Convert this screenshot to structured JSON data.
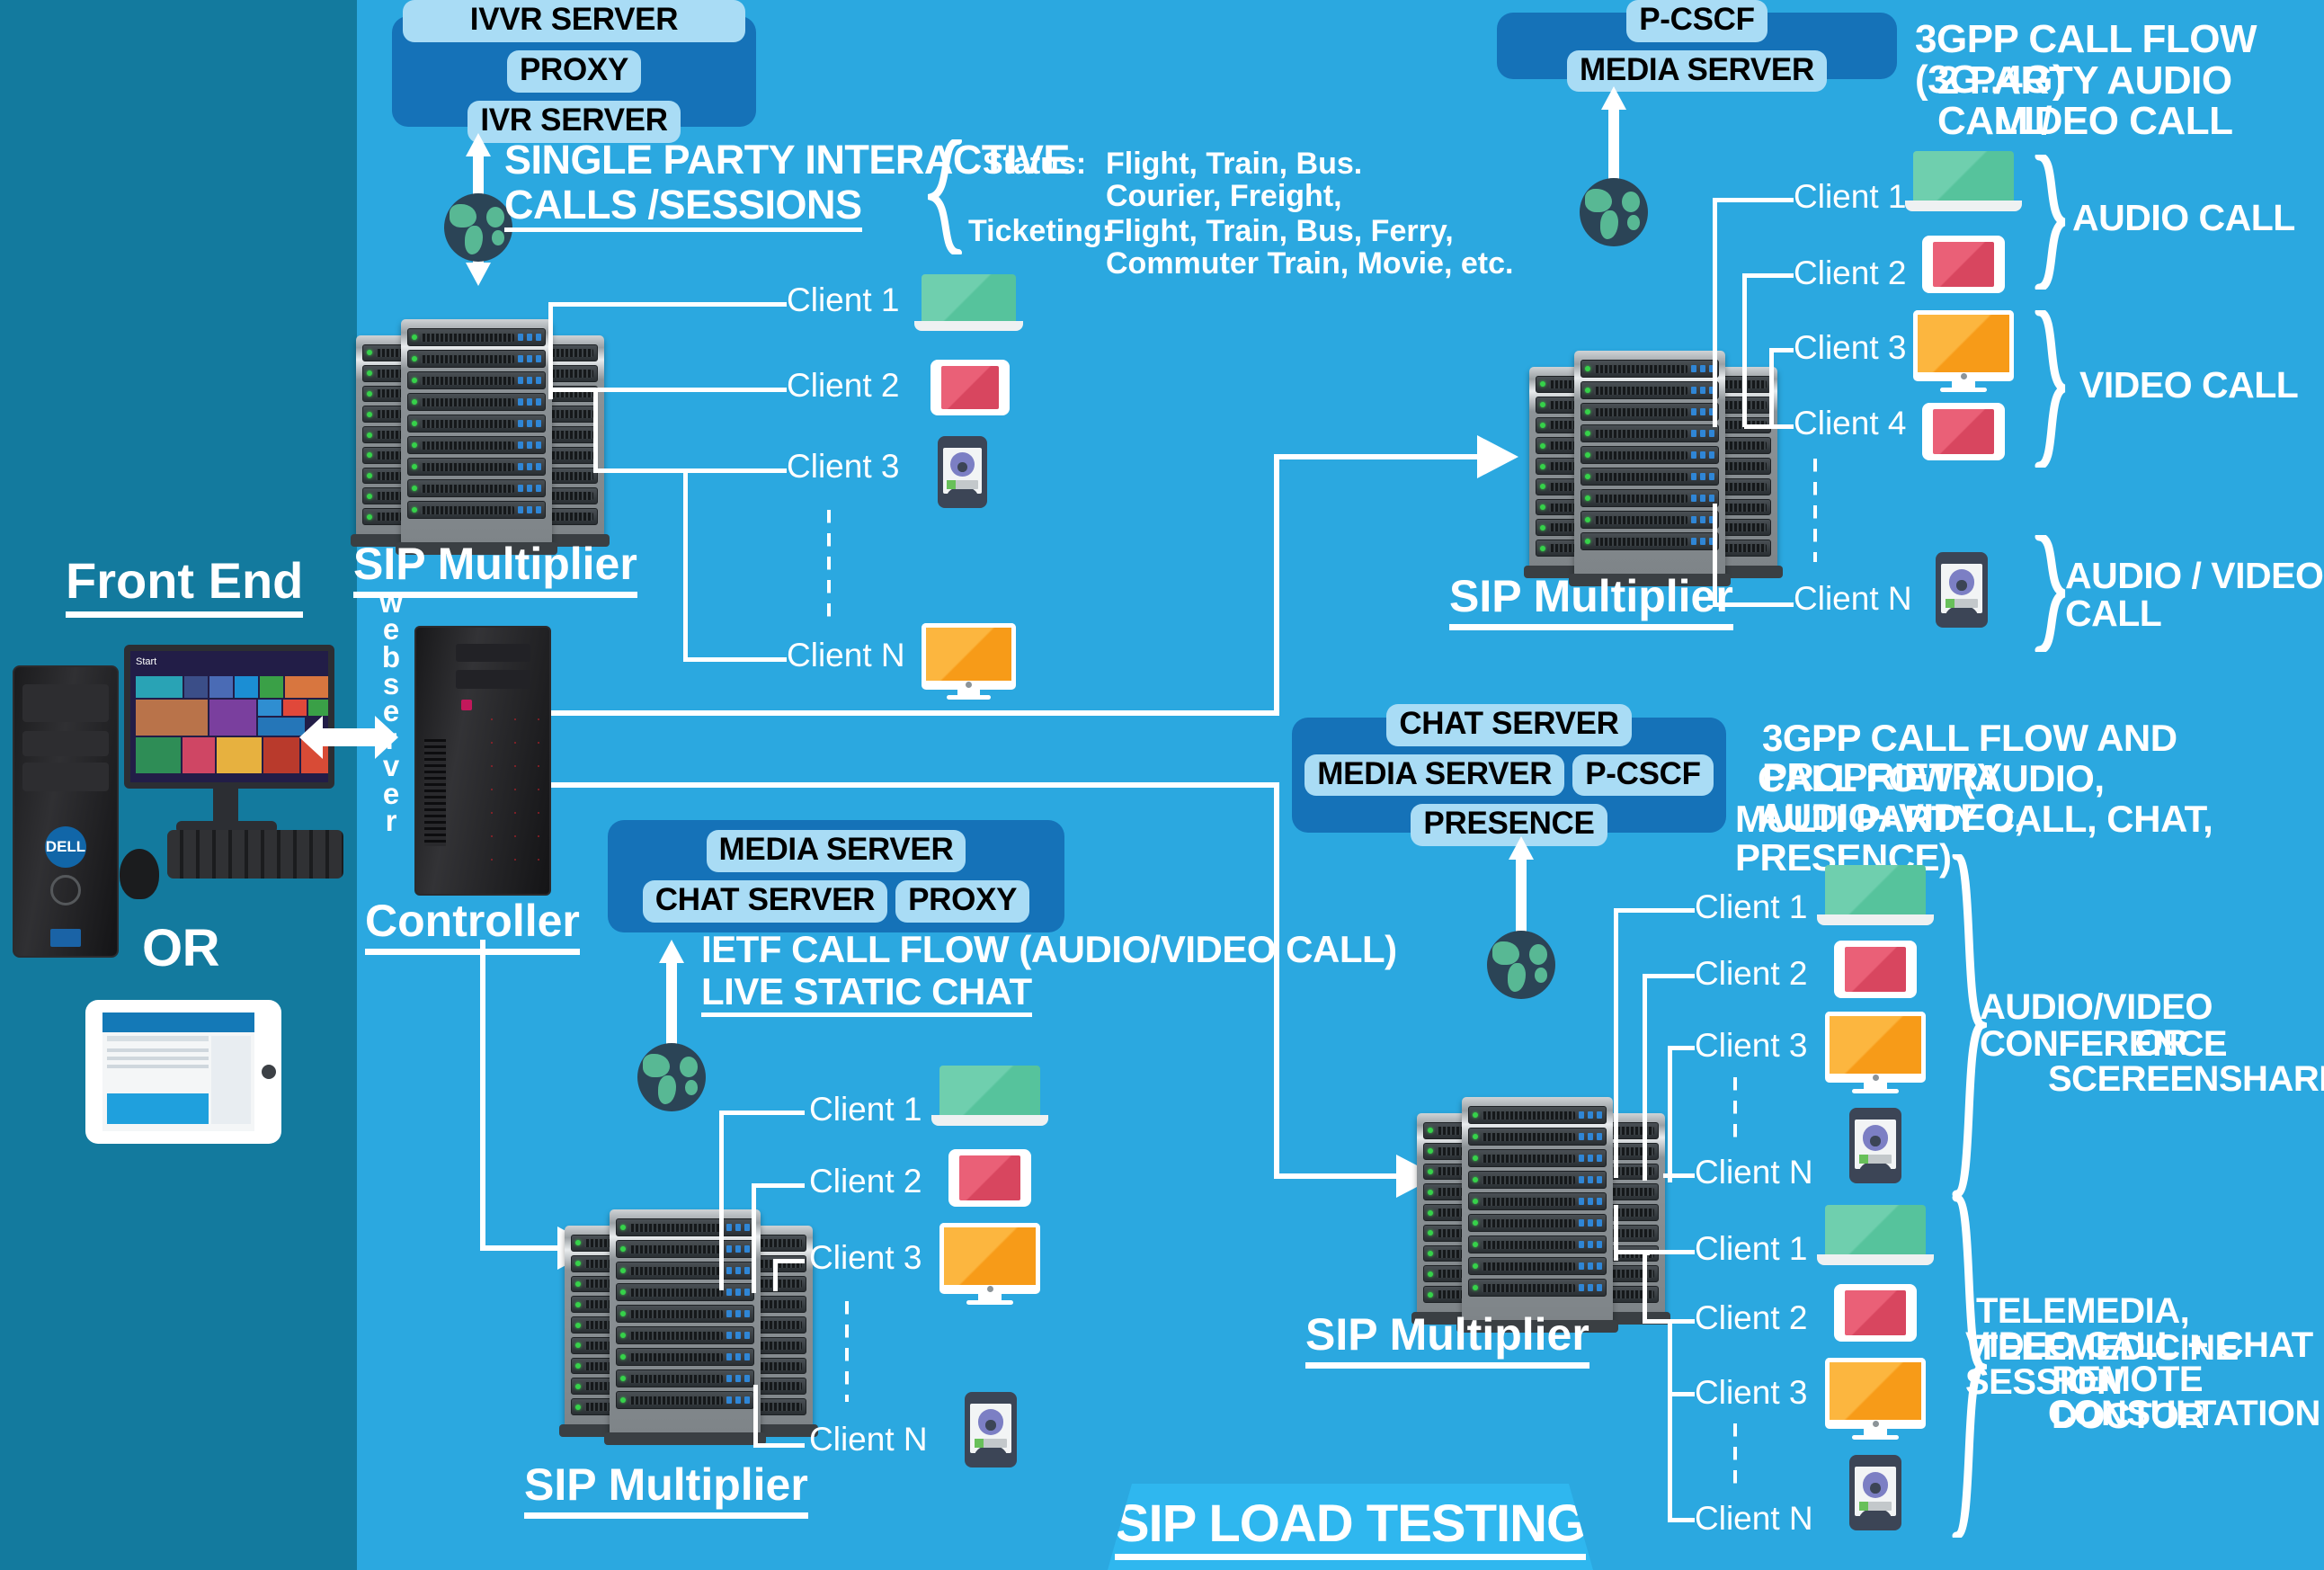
{
  "meta": {
    "background_main": "#2ba8e0",
    "background_left": "#137a9e",
    "panel_blue": "#1572b8",
    "pill_blue": "#a9dcf5"
  },
  "frontend": {
    "title": "Front End",
    "or_label": "OR"
  },
  "controller": {
    "title": "Controller",
    "webserver_label": "webserver"
  },
  "banner": {
    "label": "SIP LOAD TESTING"
  },
  "clusters": {
    "top_left": {
      "title": "SIP Multiplier",
      "server_box": {
        "top_row": [
          "IVVR SERVER"
        ],
        "bottom_row": [
          "PROXY",
          "IVR SERVER"
        ]
      },
      "flow_label": "SINGLE PARTY INTERACTIVE\nCALLS /SESSIONS",
      "flow_line1": "SINGLE PARTY INTERACTIVE",
      "flow_line2": "CALLS /SESSIONS",
      "clients": [
        "Client 1",
        "Client 2",
        "Client 3",
        "Client N"
      ],
      "notes": {
        "status_key": "Status:",
        "status_value_1": "Flight, Train, Bus.",
        "status_value_2": "Courier, Freight,",
        "ticketing_key": "Ticketing:",
        "ticketing_value_1": "Flight, Train, Bus, Ferry,",
        "ticketing_value_2": "Commuter Train, Movie, etc."
      }
    },
    "top_right": {
      "title": "SIP Multiplier",
      "server_box": {
        "top_row": [
          "P-CSCF",
          "MEDIA SERVER"
        ],
        "bottom_row": []
      },
      "heading": [
        "3GPP CALL FLOW (3G..4G)",
        "2 PARTY AUDIO CALL/",
        "VIDEO CALL"
      ],
      "clients": [
        "Client 1",
        "Client 2",
        "Client 3",
        "Client 4",
        "Client N"
      ],
      "brace_labels": [
        "AUDIO CALL",
        "VIDEO CALL",
        "AUDIO / VIDEO CALL"
      ]
    },
    "bottom_left": {
      "title": "SIP Multiplier",
      "server_box": {
        "top_row": [
          "MEDIA SERVER",
          "CHAT SERVER"
        ],
        "bottom_row": [
          "PROXY"
        ]
      },
      "flow_line1": "IETF CALL FLOW (AUDIO/VIDEO CALL)",
      "flow_line2": "LIVE STATIC CHAT",
      "clients": [
        "Client 1",
        "Client 2",
        "Client 3",
        "Client N"
      ]
    },
    "bottom_right": {
      "title": "SIP Multiplier",
      "server_box": {
        "top_row": [
          "CHAT SERVER",
          "MEDIA SERVER"
        ],
        "bottom_row": [
          "P-CSCF",
          "PRESENCE"
        ]
      },
      "heading": [
        "3GPP CALL FLOW AND PROPRIETRY",
        "CALL FOW (AUDIO, AUDIO+VIDEO,",
        "MULTI PARTY CALL, CHAT, PRESENCE)"
      ],
      "clients_upper": [
        "Client 1",
        "Client 2",
        "Client 3",
        "Client N"
      ],
      "clients_lower": [
        "Client 1",
        "Client 2",
        "Client 3",
        "Client N"
      ],
      "brace_upper": [
        "AUDIO/VIDEO CONFERENCE",
        "OR",
        "SCEREENSHARE"
      ],
      "brace_lower": [
        "TELEMEDIA, TELEMEDICINE",
        "VIDEO CALL + CHAT SESSION",
        "REMOTE DOCTOR",
        "CONSULTATION"
      ]
    }
  }
}
